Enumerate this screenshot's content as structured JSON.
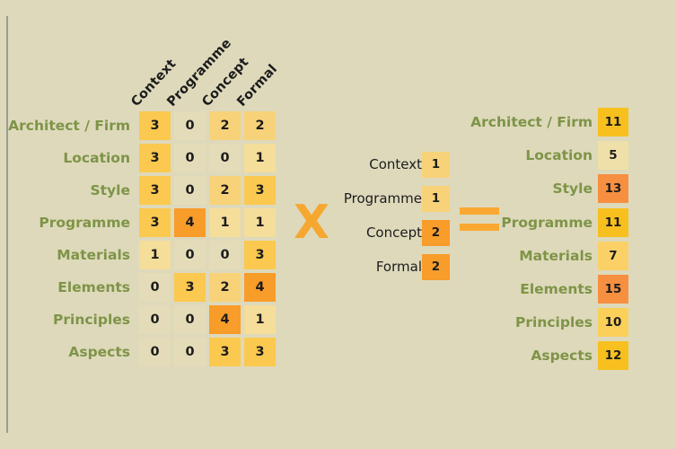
{
  "colors": {
    "background": "#ded9bb",
    "label_green": "#7e9447",
    "operator_orange": "#f6a72f",
    "text_dark": "#1c1c1c",
    "scale_0": "#e4dcb8",
    "scale_1": "#f5dd9a",
    "scale_2": "#f8d278",
    "scale_3": "#fbc94f",
    "scale_4": "#f89c2a",
    "result_low": "#efdfa8",
    "result_mid": "#fbd167",
    "result_high": "#f7c01f",
    "result_top": "#f68f40"
  },
  "matrix": {
    "column_headers": [
      "Context",
      "Programme",
      "Concept",
      "Formal"
    ],
    "row_labels": [
      "Architect / Firm",
      "Location",
      "Style",
      "Programme",
      "Materials",
      "Elements",
      "Principles",
      "Aspects"
    ],
    "values": [
      [
        "3",
        "0",
        "2",
        "2"
      ],
      [
        "3",
        "0",
        "0",
        "1"
      ],
      [
        "3",
        "0",
        "2",
        "3"
      ],
      [
        "3",
        "4",
        "1",
        "1"
      ],
      [
        "1",
        "0",
        "0",
        "3"
      ],
      [
        "0",
        "3",
        "2",
        "4"
      ],
      [
        "0",
        "0",
        "4",
        "1"
      ],
      [
        "0",
        "0",
        "3",
        "3"
      ]
    ]
  },
  "operators": {
    "multiply": "X",
    "equals": "="
  },
  "vector": {
    "labels": [
      "Context",
      "Programme",
      "Concept",
      "Formal"
    ],
    "values": [
      "1",
      "1",
      "2",
      "2"
    ]
  },
  "result": {
    "labels": [
      "Architect / Firm",
      "Location",
      "Style",
      "Programme",
      "Materials",
      "Elements",
      "Principles",
      "Aspects"
    ],
    "values": [
      "11",
      "5",
      "13",
      "11",
      "7",
      "15",
      "10",
      "12"
    ]
  },
  "chart_data": {
    "type": "table",
    "title": "",
    "description": "Matrix-vector multiplication diagram",
    "matrix_rows": [
      "Architect / Firm",
      "Location",
      "Style",
      "Programme",
      "Materials",
      "Elements",
      "Principles",
      "Aspects"
    ],
    "matrix_columns": [
      "Context",
      "Programme",
      "Concept",
      "Formal"
    ],
    "matrix": [
      [
        3,
        0,
        2,
        2
      ],
      [
        3,
        0,
        0,
        1
      ],
      [
        3,
        0,
        2,
        3
      ],
      [
        3,
        4,
        1,
        1
      ],
      [
        1,
        0,
        0,
        3
      ],
      [
        0,
        3,
        2,
        4
      ],
      [
        0,
        0,
        4,
        1
      ],
      [
        0,
        0,
        3,
        3
      ]
    ],
    "vector_labels": [
      "Context",
      "Programme",
      "Concept",
      "Formal"
    ],
    "vector": [
      1,
      1,
      2,
      2
    ],
    "result_labels": [
      "Architect / Firm",
      "Location",
      "Style",
      "Programme",
      "Materials",
      "Elements",
      "Principles",
      "Aspects"
    ],
    "result": [
      11,
      5,
      13,
      11,
      7,
      15,
      10,
      12
    ]
  }
}
